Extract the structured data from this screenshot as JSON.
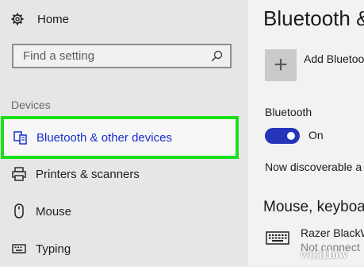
{
  "sidebar": {
    "home_label": "Home",
    "search_placeholder": "Find a setting",
    "section_label": "Devices",
    "items": [
      {
        "label": "Bluetooth & other devices",
        "icon": "bluetooth-devices-icon"
      },
      {
        "label": "Printers & scanners",
        "icon": "printer-icon"
      },
      {
        "label": "Mouse",
        "icon": "mouse-icon"
      },
      {
        "label": "Typing",
        "icon": "keyboard-icon"
      }
    ]
  },
  "main": {
    "title": "Bluetooth &",
    "add_label": "Add Bluetoo",
    "bluetooth_label": "Bluetooth",
    "toggle_state": "On",
    "discoverable_text": "Now discoverable a",
    "section2_title": "Mouse, keyboa",
    "device": {
      "name": "Razer BlackW",
      "status": "Not connect"
    }
  },
  "watermark": {
    "wiki": "wiki",
    "how": "How"
  },
  "colors": {
    "accent": "#2534b8",
    "highlight": "#19e019",
    "active_text": "#1a2fcf"
  }
}
